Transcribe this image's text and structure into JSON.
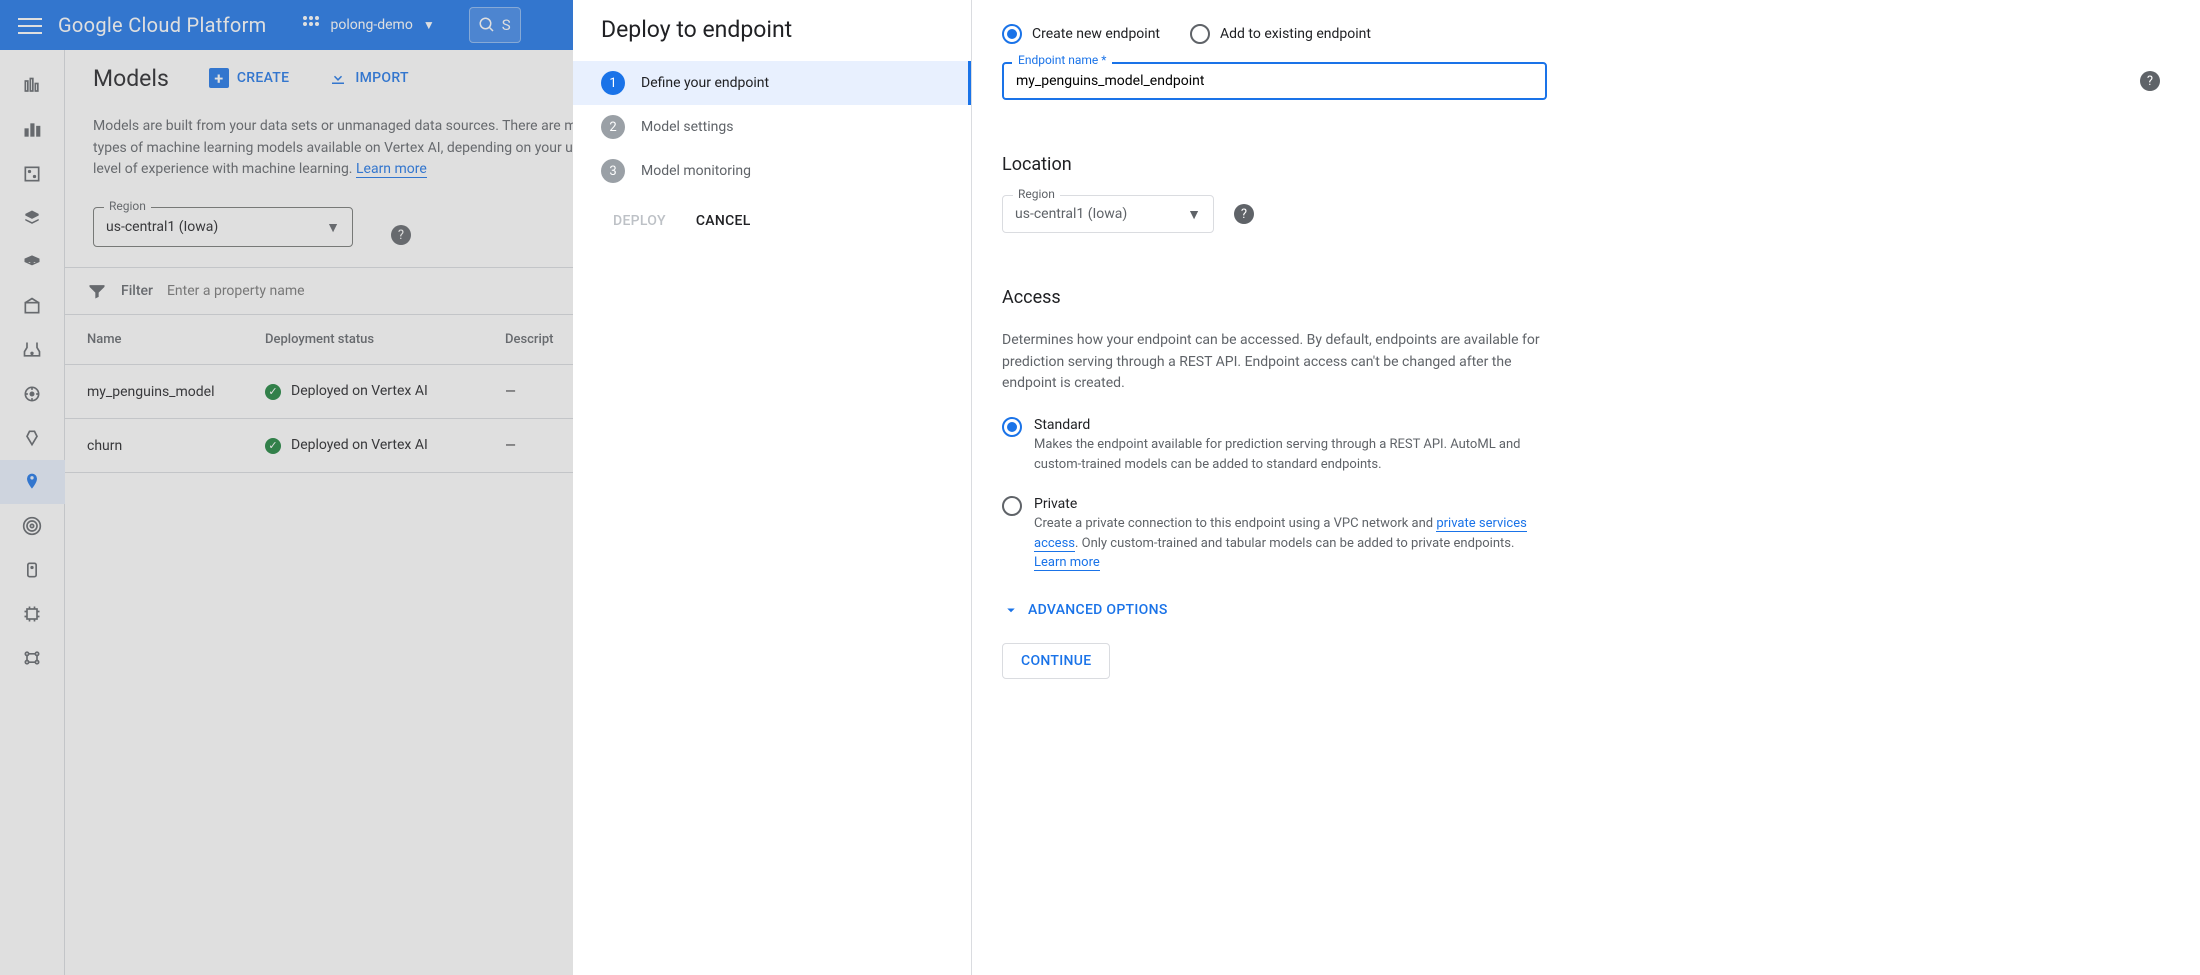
{
  "topbar": {
    "product": "Google Cloud Platform",
    "project": "polong-demo",
    "search_prefix": "S"
  },
  "leftnav": {
    "items": [
      "i0",
      "i1",
      "i2",
      "i3",
      "i4",
      "i5",
      "i6",
      "i7",
      "i8",
      "i9",
      "i10",
      "i11",
      "i12"
    ]
  },
  "page": {
    "title": "Models",
    "create": "CREATE",
    "import": "IMPORT",
    "intro": "Models are built from your data sets or unmanaged data sources. There are many different types of machine learning models available on Vertex AI, depending on your use case and level of experience with machine learning.",
    "learn_more": "Learn more",
    "region_label": "Region",
    "region_value": "us-central1 (Iowa)"
  },
  "filter": {
    "label": "Filter",
    "placeholder": "Enter a property name"
  },
  "table": {
    "headers": {
      "name": "Name",
      "status": "Deployment status",
      "desc": "Descript"
    },
    "rows": [
      {
        "name": "my_penguins_model",
        "status": "Deployed on Vertex AI",
        "desc": "—"
      },
      {
        "name": "churn",
        "status": "Deployed on Vertex AI",
        "desc": "—"
      }
    ]
  },
  "wizard": {
    "title": "Deploy to endpoint",
    "steps": [
      "Define your endpoint",
      "Model settings",
      "Model monitoring"
    ],
    "deploy": "DEPLOY",
    "cancel": "CANCEL"
  },
  "form": {
    "mode_create": "Create new endpoint",
    "mode_existing": "Add to existing endpoint",
    "endpoint_label": "Endpoint name *",
    "endpoint_value": "my_penguins_model_endpoint",
    "location_title": "Location",
    "region_label": "Region",
    "region_value": "us-central1 (Iowa)",
    "access_title": "Access",
    "access_desc": "Determines how your endpoint can be accessed. By default, endpoints are available for prediction serving through a REST API. Endpoint access can't be changed after the endpoint is created.",
    "standard_title": "Standard",
    "standard_desc": "Makes the endpoint available for prediction serving through a REST API. AutoML and custom-trained models can be added to standard endpoints.",
    "private_title": "Private",
    "private_desc_a": "Create a private connection to this endpoint using a VPC network and ",
    "private_link": "private services access",
    "private_desc_b": ". Only custom-trained and tabular models can be added to private endpoints. ",
    "private_learn": "Learn more",
    "advanced": "ADVANCED OPTIONS",
    "continue": "CONTINUE"
  }
}
